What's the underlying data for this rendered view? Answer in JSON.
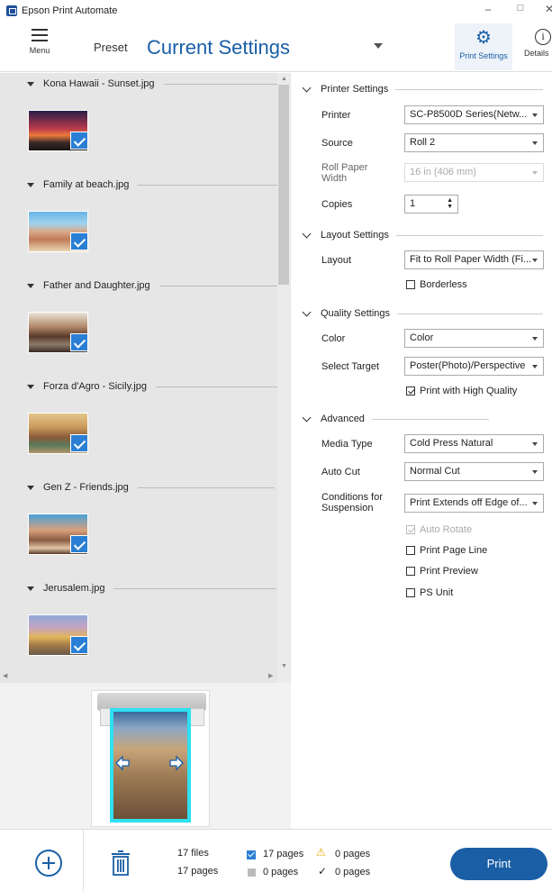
{
  "window": {
    "title": "Epson Print Automate"
  },
  "header": {
    "menu_label": "Menu",
    "preset_label": "Preset",
    "preset_value": "Current Settings",
    "tabs": [
      {
        "label": "Print Settings",
        "icon": "gear-icon",
        "active": true
      },
      {
        "label": "Details",
        "icon": "info-icon",
        "active": false
      }
    ]
  },
  "files": [
    {
      "name": "Kona Hawaii - Sunset.jpg",
      "checked": true
    },
    {
      "name": "Family at beach.jpg",
      "checked": true
    },
    {
      "name": "Father and Daughter.jpg",
      "checked": true
    },
    {
      "name": "Forza d'Agro - Sicily.jpg",
      "checked": true
    },
    {
      "name": "Gen Z - Friends.jpg",
      "checked": true
    },
    {
      "name": "Jerusalem.jpg",
      "checked": true
    }
  ],
  "settings": {
    "printer_section": "Printer Settings",
    "printer_label": "Printer",
    "printer_value": "SC-P8500D Series(Netw...",
    "source_label": "Source",
    "source_value": "Roll 2",
    "roll_width_label": "Roll Paper Width",
    "roll_width_value": "16 in (406 mm)",
    "copies_label": "Copies",
    "copies_value": "1",
    "layout_section": "Layout Settings",
    "layout_label": "Layout",
    "layout_value": "Fit to Roll Paper Width (Fi...",
    "borderless_label": "Borderless",
    "quality_section": "Quality Settings",
    "color_label": "Color",
    "color_value": "Color",
    "target_label": "Select Target",
    "target_value": "Poster(Photo)/Perspective",
    "high_quality_label": "Print with High Quality",
    "advanced_section": "Advanced",
    "media_label": "Media Type",
    "media_value": "Cold Press Natural",
    "autocut_label": "Auto Cut",
    "autocut_value": "Normal Cut",
    "suspension_label": "Conditions for Suspension",
    "suspension_value": "Print Extends off Edge of...",
    "auto_rotate_label": "Auto Rotate",
    "page_line_label": "Print Page Line",
    "print_preview_label": "Print Preview",
    "ps_unit_label": "PS Unit"
  },
  "footer": {
    "files_count": "17 files",
    "pages_count": "17 pages",
    "checked_pages": "17 pages",
    "gray_pages": "0 pages",
    "warning_pages": "0 pages",
    "done_pages": "0 pages",
    "print_label": "Print"
  },
  "colors": {
    "accent": "#1a5fa6",
    "check": "#2a7fd4",
    "preview_border": "#2ee0f0",
    "warning": "#e2a800"
  }
}
